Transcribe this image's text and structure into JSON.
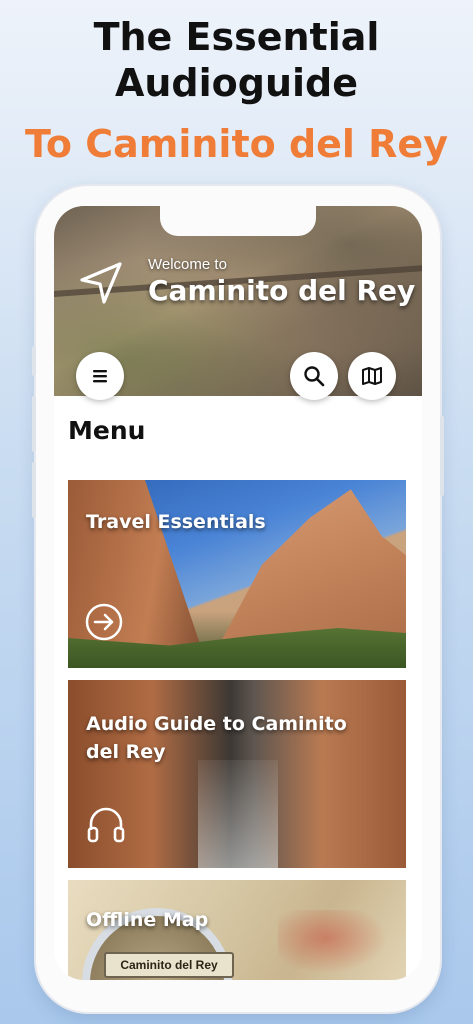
{
  "promo": {
    "title_line1": "The Essential",
    "title_line2": "Audioguide",
    "subtitle": "To Caminito del Rey"
  },
  "hero": {
    "welcome": "Welcome to",
    "title": "Caminito del Rey"
  },
  "menu": {
    "heading": "Menu",
    "cards": [
      {
        "title": "Travel Essentials",
        "icon": "arrow-right-circle-icon"
      },
      {
        "title": "Audio Guide to Caminito del Rey",
        "icon": "headphones-icon"
      },
      {
        "title": "Offline Map",
        "sign_text": "Caminito del Rey"
      }
    ]
  },
  "icons": {
    "hero": "navigation-arrow-icon",
    "hamburger": "hamburger-menu-icon",
    "search": "search-icon",
    "map": "map-icon"
  },
  "colors": {
    "accent": "#ef7d38",
    "title": "#111111"
  }
}
